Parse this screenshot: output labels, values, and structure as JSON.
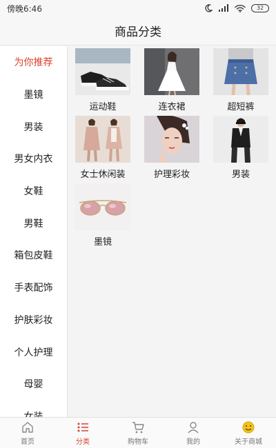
{
  "status_bar": {
    "time": "傍晚6:46",
    "battery": "32",
    "icons": [
      "moon-icon",
      "signal-icon",
      "wifi-icon",
      "battery-icon"
    ]
  },
  "header": {
    "title": "商品分类"
  },
  "sidebar": {
    "active_color": "#d8432b",
    "items": [
      {
        "label": "为你推荐",
        "active": true
      },
      {
        "label": "墨镜"
      },
      {
        "label": "男装"
      },
      {
        "label": "男女内衣"
      },
      {
        "label": "女鞋"
      },
      {
        "label": "男鞋"
      },
      {
        "label": "箱包皮鞋"
      },
      {
        "label": "手表配饰"
      },
      {
        "label": "护肤彩妆"
      },
      {
        "label": "个人护理"
      },
      {
        "label": "母婴"
      },
      {
        "label": "女装"
      }
    ]
  },
  "products": [
    {
      "label": "运动鞋",
      "icon": "sneaker-image"
    },
    {
      "label": "连衣裙",
      "icon": "dress-image"
    },
    {
      "label": "超短裤",
      "icon": "denim-skirt-image"
    },
    {
      "label": "女士休闲装",
      "icon": "womens-casual-image"
    },
    {
      "label": "护理彩妆",
      "icon": "makeup-image"
    },
    {
      "label": "男装",
      "icon": "menswear-image"
    },
    {
      "label": "墨镜",
      "icon": "sunglasses-image"
    }
  ],
  "tabbar": {
    "items": [
      {
        "label": "首页",
        "icon": "home-icon"
      },
      {
        "label": "分类",
        "icon": "list-icon",
        "active": true
      },
      {
        "label": "购物车",
        "icon": "cart-icon"
      },
      {
        "label": "我的",
        "icon": "user-icon"
      },
      {
        "label": "关于商城",
        "icon": "smiley-icon"
      }
    ]
  }
}
